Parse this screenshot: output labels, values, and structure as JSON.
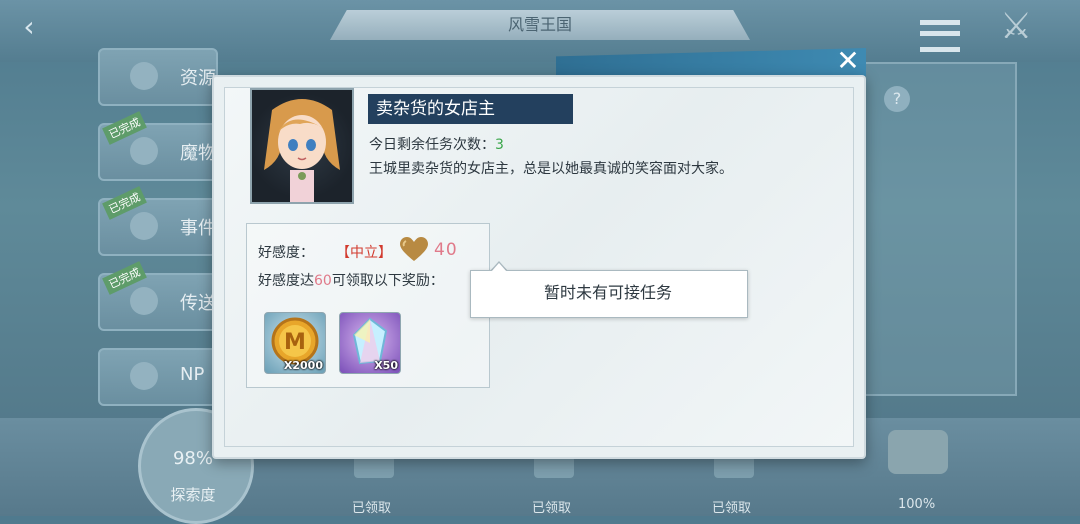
{
  "background": {
    "title": "风雪王国",
    "list_items": [
      {
        "label": "资源",
        "badge": ""
      },
      {
        "label": "魔物",
        "badge": "已完成"
      },
      {
        "label": "事件",
        "badge": "已完成"
      },
      {
        "label": "传送",
        "badge": "已完成"
      },
      {
        "label": "NP",
        "badge": ""
      }
    ],
    "explore_percent": "98%",
    "explore_label": "探索度",
    "rewards_claimed": [
      "已领取",
      "已领取",
      "已领取"
    ],
    "final_percent": "100%"
  },
  "dialog": {
    "npc_name": "卖杂货的女店主",
    "task_prefix": "今日剩余任务次数：",
    "task_count": "3",
    "description": "王城里卖杂货的女店主，总是以她最真诚的笑容面对大家。",
    "favor_label": "好感度：",
    "favor_status": "【中立】",
    "favor_value": "40",
    "reward_prefix": "好感度达",
    "reward_threshold": "60",
    "reward_suffix": "可领取以下奖励：",
    "rewards": [
      {
        "icon": "m-coin-icon",
        "qty": "X2000"
      },
      {
        "icon": "crystal-icon",
        "qty": "X50"
      }
    ],
    "tooltip": "暂时未有可接任务"
  },
  "colors": {
    "name_banner": "#23405e",
    "task_count": "#3aa64a",
    "favor_status": "#d23a2e",
    "favor_value": "#e07a8a"
  }
}
